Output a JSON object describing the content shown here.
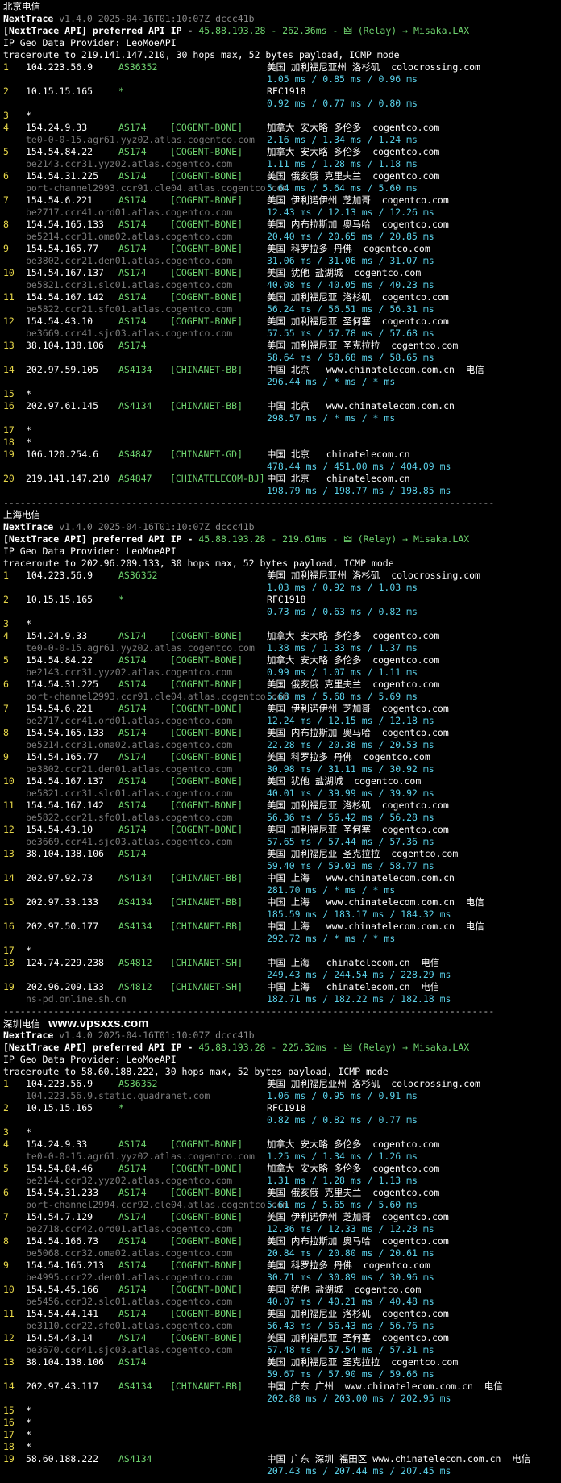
{
  "watermark": "www.vpsxxs.com",
  "sections": [
    {
      "title": "北京电信",
      "nexttrace_label": "NextTrace",
      "version": "v1.4.0 2025-04-16T01:10:07Z dccc41b",
      "api_prefix": "[NextTrace API] preferred API IP - ",
      "api_detail": "45.88.193.28 - 262.36ms - 🜲 (Relay) → Misaka.LAX",
      "geo_provider": "IP Geo Data Provider: LeoMoeAPI",
      "traceroute": "traceroute to 219.141.147.210, 30 hops max, 52 bytes payload, ICMP mode",
      "hops": [
        {
          "n": "1",
          "ip": "104.223.56.9",
          "asn": "AS36352",
          "tag": "",
          "geo": "美国 加利福尼亚州 洛杉矶  colocrossing.com",
          "host": "",
          "rtt": "1.05 ms / 0.85 ms / 0.96 ms"
        },
        {
          "n": "2",
          "ip": "10.15.15.165",
          "asn": "*",
          "tag": "",
          "geo": "RFC1918",
          "host": "",
          "rtt": "0.92 ms / 0.77 ms / 0.80 ms"
        },
        {
          "n": "3",
          "ip": "*",
          "asn": "",
          "tag": "",
          "geo": "",
          "host": "",
          "rtt": ""
        },
        {
          "n": "4",
          "ip": "154.24.9.33",
          "asn": "AS174",
          "tag": "[COGENT-BONE]",
          "geo": "加拿大 安大略 多伦多  cogentco.com",
          "host": "te0-0-0-15.agr61.yyz02.atlas.cogentco.com",
          "rtt": "2.16 ms / 1.34 ms / 1.24 ms"
        },
        {
          "n": "5",
          "ip": "154.54.84.22",
          "asn": "AS174",
          "tag": "[COGENT-BONE]",
          "geo": "加拿大 安大略 多伦多  cogentco.com",
          "host": "be2143.ccr31.yyz02.atlas.cogentco.com",
          "rtt": "1.11 ms / 1.28 ms / 1.18 ms"
        },
        {
          "n": "6",
          "ip": "154.54.31.225",
          "asn": "AS174",
          "tag": "[COGENT-BONE]",
          "geo": "美国 俄亥俄 克里夫兰  cogentco.com",
          "host": "port-channel2993.ccr91.cle04.atlas.cogentco.com",
          "rtt": "5.64 ms / 5.64 ms / 5.60 ms"
        },
        {
          "n": "7",
          "ip": "154.54.6.221",
          "asn": "AS174",
          "tag": "[COGENT-BONE]",
          "geo": "美国 伊利诺伊州 芝加哥  cogentco.com",
          "host": "be2717.ccr41.ord01.atlas.cogentco.com",
          "rtt": "12.43 ms / 12.13 ms / 12.26 ms"
        },
        {
          "n": "8",
          "ip": "154.54.165.133",
          "asn": "AS174",
          "tag": "[COGENT-BONE]",
          "geo": "美国 内布拉斯加 奥马哈  cogentco.com",
          "host": "be5214.ccr31.oma02.atlas.cogentco.com",
          "rtt": "20.40 ms / 20.65 ms / 20.85 ms"
        },
        {
          "n": "9",
          "ip": "154.54.165.77",
          "asn": "AS174",
          "tag": "[COGENT-BONE]",
          "geo": "美国 科罗拉多 丹佛  cogentco.com",
          "host": "be3802.ccr21.den01.atlas.cogentco.com",
          "rtt": "31.06 ms / 31.06 ms / 31.07 ms"
        },
        {
          "n": "10",
          "ip": "154.54.167.137",
          "asn": "AS174",
          "tag": "[COGENT-BONE]",
          "geo": "美国 犹他 盐湖城  cogentco.com",
          "host": "be5821.ccr31.slc01.atlas.cogentco.com",
          "rtt": "40.08 ms / 40.05 ms / 40.23 ms"
        },
        {
          "n": "11",
          "ip": "154.54.167.142",
          "asn": "AS174",
          "tag": "[COGENT-BONE]",
          "geo": "美国 加利福尼亚 洛杉矶  cogentco.com",
          "host": "be5822.ccr21.sfo01.atlas.cogentco.com",
          "rtt": "56.24 ms / 56.51 ms / 56.31 ms"
        },
        {
          "n": "12",
          "ip": "154.54.43.10",
          "asn": "AS174",
          "tag": "[COGENT-BONE]",
          "geo": "美国 加利福尼亚 圣何塞  cogentco.com",
          "host": "be3669.ccr41.sjc03.atlas.cogentco.com",
          "rtt": "57.55 ms / 57.78 ms / 57.68 ms"
        },
        {
          "n": "13",
          "ip": "38.104.138.106",
          "asn": "AS174",
          "tag": "",
          "geo": "美国 加利福尼亚 圣克拉拉  cogentco.com",
          "host": "",
          "rtt": "58.64 ms / 58.68 ms / 58.65 ms"
        },
        {
          "n": "14",
          "ip": "202.97.59.105",
          "asn": "AS4134",
          "tag": "[CHINANET-BB]",
          "geo": "中国 北京   www.chinatelecom.com.cn  电信",
          "host": "",
          "rtt": "296.44 ms / * ms / * ms"
        },
        {
          "n": "15",
          "ip": "*",
          "asn": "",
          "tag": "",
          "geo": "",
          "host": "",
          "rtt": ""
        },
        {
          "n": "16",
          "ip": "202.97.61.145",
          "asn": "AS4134",
          "tag": "[CHINANET-BB]",
          "geo": "中国 北京   www.chinatelecom.com.cn",
          "host": "",
          "rtt": "298.57 ms / * ms / * ms"
        },
        {
          "n": "17",
          "ip": "*",
          "asn": "",
          "tag": "",
          "geo": "",
          "host": "",
          "rtt": ""
        },
        {
          "n": "18",
          "ip": "*",
          "asn": "",
          "tag": "",
          "geo": "",
          "host": "",
          "rtt": ""
        },
        {
          "n": "19",
          "ip": "106.120.254.6",
          "asn": "AS4847",
          "tag": "[CHINANET-GD]",
          "geo": "中国 北京   chinatelecom.cn",
          "host": "",
          "rtt": "478.44 ms / 451.00 ms / 404.09 ms"
        },
        {
          "n": "20",
          "ip": "219.141.147.210",
          "asn": "AS4847",
          "tag": "[CHINATELECOM-BJ]",
          "geo": "中国 北京   chinatelecom.cn",
          "host": "",
          "rtt": "198.79 ms / 198.77 ms / 198.85 ms"
        }
      ]
    },
    {
      "title": "上海电信",
      "nexttrace_label": "NextTrace",
      "version": "v1.4.0 2025-04-16T01:10:07Z dccc41b",
      "api_prefix": "[NextTrace API] preferred API IP - ",
      "api_detail": "45.88.193.28 - 219.61ms - 🜲 (Relay) → Misaka.LAX",
      "geo_provider": "IP Geo Data Provider: LeoMoeAPI",
      "traceroute": "traceroute to 202.96.209.133, 30 hops max, 52 bytes payload, ICMP mode",
      "hops": [
        {
          "n": "1",
          "ip": "104.223.56.9",
          "asn": "AS36352",
          "tag": "",
          "geo": "美国 加利福尼亚州 洛杉矶  colocrossing.com",
          "host": "",
          "rtt": "1.03 ms / 0.92 ms / 1.03 ms"
        },
        {
          "n": "2",
          "ip": "10.15.15.165",
          "asn": "*",
          "tag": "",
          "geo": "RFC1918",
          "host": "",
          "rtt": "0.73 ms / 0.63 ms / 0.82 ms"
        },
        {
          "n": "3",
          "ip": "*",
          "asn": "",
          "tag": "",
          "geo": "",
          "host": "",
          "rtt": ""
        },
        {
          "n": "4",
          "ip": "154.24.9.33",
          "asn": "AS174",
          "tag": "[COGENT-BONE]",
          "geo": "加拿大 安大略 多伦多  cogentco.com",
          "host": "te0-0-0-15.agr61.yyz02.atlas.cogentco.com",
          "rtt": "1.38 ms / 1.33 ms / 1.37 ms"
        },
        {
          "n": "5",
          "ip": "154.54.84.22",
          "asn": "AS174",
          "tag": "[COGENT-BONE]",
          "geo": "加拿大 安大略 多伦多  cogentco.com",
          "host": "be2143.ccr31.yyz02.atlas.cogentco.com",
          "rtt": "0.99 ms / 1.07 ms / 1.11 ms"
        },
        {
          "n": "6",
          "ip": "154.54.31.225",
          "asn": "AS174",
          "tag": "[COGENT-BONE]",
          "geo": "美国 俄亥俄 克里夫兰  cogentco.com",
          "host": "port-channel2993.ccr91.cle04.atlas.cogentco.com",
          "rtt": "5.68 ms / 5.68 ms / 5.69 ms"
        },
        {
          "n": "7",
          "ip": "154.54.6.221",
          "asn": "AS174",
          "tag": "[COGENT-BONE]",
          "geo": "美国 伊利诺伊州 芝加哥  cogentco.com",
          "host": "be2717.ccr41.ord01.atlas.cogentco.com",
          "rtt": "12.24 ms / 12.15 ms / 12.18 ms"
        },
        {
          "n": "8",
          "ip": "154.54.165.133",
          "asn": "AS174",
          "tag": "[COGENT-BONE]",
          "geo": "美国 内布拉斯加 奥马哈  cogentco.com",
          "host": "be5214.ccr31.oma02.atlas.cogentco.com",
          "rtt": "22.28 ms / 20.38 ms / 20.53 ms"
        },
        {
          "n": "9",
          "ip": "154.54.165.77",
          "asn": "AS174",
          "tag": "[COGENT-BONE]",
          "geo": "美国 科罗拉多 丹佛  cogentco.com",
          "host": "be3802.ccr21.den01.atlas.cogentco.com",
          "rtt": "30.98 ms / 31.11 ms / 30.92 ms"
        },
        {
          "n": "10",
          "ip": "154.54.167.137",
          "asn": "AS174",
          "tag": "[COGENT-BONE]",
          "geo": "美国 犹他 盐湖城  cogentco.com",
          "host": "be5821.ccr31.slc01.atlas.cogentco.com",
          "rtt": "40.01 ms / 39.99 ms / 39.92 ms"
        },
        {
          "n": "11",
          "ip": "154.54.167.142",
          "asn": "AS174",
          "tag": "[COGENT-BONE]",
          "geo": "美国 加利福尼亚 洛杉矶  cogentco.com",
          "host": "be5822.ccr21.sfo01.atlas.cogentco.com",
          "rtt": "56.36 ms / 56.42 ms / 56.28 ms"
        },
        {
          "n": "12",
          "ip": "154.54.43.10",
          "asn": "AS174",
          "tag": "[COGENT-BONE]",
          "geo": "美国 加利福尼亚 圣何塞  cogentco.com",
          "host": "be3669.ccr41.sjc03.atlas.cogentco.com",
          "rtt": "57.65 ms / 57.44 ms / 57.36 ms"
        },
        {
          "n": "13",
          "ip": "38.104.138.106",
          "asn": "AS174",
          "tag": "",
          "geo": "美国 加利福尼亚 圣克拉拉  cogentco.com",
          "host": "",
          "rtt": "59.40 ms / 59.03 ms / 58.77 ms"
        },
        {
          "n": "14",
          "ip": "202.97.92.73",
          "asn": "AS4134",
          "tag": "[CHINANET-BB]",
          "geo": "中国 上海   www.chinatelecom.com.cn",
          "host": "",
          "rtt": "281.70 ms / * ms / * ms"
        },
        {
          "n": "15",
          "ip": "202.97.33.133",
          "asn": "AS4134",
          "tag": "[CHINANET-BB]",
          "geo": "中国 上海   www.chinatelecom.com.cn  电信",
          "host": "",
          "rtt": "185.59 ms / 183.17 ms / 184.32 ms"
        },
        {
          "n": "16",
          "ip": "202.97.50.177",
          "asn": "AS4134",
          "tag": "[CHINANET-BB]",
          "geo": "中国 上海   www.chinatelecom.com.cn  电信",
          "host": "",
          "rtt": "292.72 ms / * ms / * ms"
        },
        {
          "n": "17",
          "ip": "*",
          "asn": "",
          "tag": "",
          "geo": "",
          "host": "",
          "rtt": ""
        },
        {
          "n": "18",
          "ip": "124.74.229.238",
          "asn": "AS4812",
          "tag": "[CHINANET-SH]",
          "geo": "中国 上海   chinatelecom.cn  电信",
          "host": "",
          "rtt": "249.43 ms / 244.54 ms / 228.29 ms"
        },
        {
          "n": "19",
          "ip": "202.96.209.133",
          "asn": "AS4812",
          "tag": "[CHINANET-SH]",
          "geo": "中国 上海   chinatelecom.cn  电信",
          "host": "ns-pd.online.sh.cn",
          "rtt": "182.71 ms / 182.22 ms / 182.18 ms"
        }
      ]
    },
    {
      "title": "深圳电信",
      "nexttrace_label": "NextTrace",
      "version": "v1.4.0 2025-04-16T01:10:07Z dccc41b",
      "api_prefix": "[NextTrace API] preferred API IP - ",
      "api_detail": "45.88.193.28 - 225.32ms - 🜲 (Relay) → Misaka.LAX",
      "geo_provider": "IP Geo Data Provider: LeoMoeAPI",
      "traceroute": "traceroute to 58.60.188.222, 30 hops max, 52 bytes payload, ICMP mode",
      "hops": [
        {
          "n": "1",
          "ip": "104.223.56.9",
          "asn": "AS36352",
          "tag": "",
          "geo": "美国 加利福尼亚州 洛杉矶  colocrossing.com",
          "host": "104.223.56.9.static.quadranet.com",
          "rtt": "1.06 ms / 0.95 ms / 0.91 ms"
        },
        {
          "n": "2",
          "ip": "10.15.15.165",
          "asn": "*",
          "tag": "",
          "geo": "RFC1918",
          "host": "",
          "rtt": "0.82 ms / 0.82 ms / 0.77 ms"
        },
        {
          "n": "3",
          "ip": "*",
          "asn": "",
          "tag": "",
          "geo": "",
          "host": "",
          "rtt": ""
        },
        {
          "n": "4",
          "ip": "154.24.9.33",
          "asn": "AS174",
          "tag": "[COGENT-BONE]",
          "geo": "加拿大 安大略 多伦多  cogentco.com",
          "host": "te0-0-0-15.agr61.yyz02.atlas.cogentco.com",
          "rtt": "1.25 ms / 1.34 ms / 1.26 ms"
        },
        {
          "n": "5",
          "ip": "154.54.84.46",
          "asn": "AS174",
          "tag": "[COGENT-BONE]",
          "geo": "加拿大 安大略 多伦多  cogentco.com",
          "host": "be2144.ccr32.yyz02.atlas.cogentco.com",
          "rtt": "1.31 ms / 1.28 ms / 1.13 ms"
        },
        {
          "n": "6",
          "ip": "154.54.31.233",
          "asn": "AS174",
          "tag": "[COGENT-BONE]",
          "geo": "美国 俄亥俄 克里夫兰  cogentco.com",
          "host": "port-channel2994.ccr92.cle04.atlas.cogentco.com",
          "rtt": "5.61 ms / 5.65 ms / 5.60 ms"
        },
        {
          "n": "7",
          "ip": "154.54.7.129",
          "asn": "AS174",
          "tag": "[COGENT-BONE]",
          "geo": "美国 伊利诺伊州 芝加哥  cogentco.com",
          "host": "be2718.ccr42.ord01.atlas.cogentco.com",
          "rtt": "12.36 ms / 12.33 ms / 12.28 ms"
        },
        {
          "n": "8",
          "ip": "154.54.166.73",
          "asn": "AS174",
          "tag": "[COGENT-BONE]",
          "geo": "美国 内布拉斯加 奥马哈  cogentco.com",
          "host": "be5068.ccr32.oma02.atlas.cogentco.com",
          "rtt": "20.84 ms / 20.80 ms / 20.61 ms"
        },
        {
          "n": "9",
          "ip": "154.54.165.213",
          "asn": "AS174",
          "tag": "[COGENT-BONE]",
          "geo": "美国 科罗拉多 丹佛  cogentco.com",
          "host": "be4995.ccr22.den01.atlas.cogentco.com",
          "rtt": "30.71 ms / 30.89 ms / 30.96 ms"
        },
        {
          "n": "10",
          "ip": "154.54.45.166",
          "asn": "AS174",
          "tag": "[COGENT-BONE]",
          "geo": "美国 犹他 盐湖城  cogentco.com",
          "host": "be5456.ccr32.slc01.atlas.cogentco.com",
          "rtt": "40.07 ms / 40.21 ms / 40.48 ms"
        },
        {
          "n": "11",
          "ip": "154.54.44.141",
          "asn": "AS174",
          "tag": "[COGENT-BONE]",
          "geo": "美国 加利福尼亚 洛杉矶  cogentco.com",
          "host": "be3110.ccr22.sfo01.atlas.cogentco.com",
          "rtt": "56.43 ms / 56.43 ms / 56.76 ms"
        },
        {
          "n": "12",
          "ip": "154.54.43.14",
          "asn": "AS174",
          "tag": "[COGENT-BONE]",
          "geo": "美国 加利福尼亚 圣何塞  cogentco.com",
          "host": "be3670.ccr41.sjc03.atlas.cogentco.com",
          "rtt": "57.48 ms / 57.54 ms / 57.31 ms"
        },
        {
          "n": "13",
          "ip": "38.104.138.106",
          "asn": "AS174",
          "tag": "",
          "geo": "美国 加利福尼亚 圣克拉拉  cogentco.com",
          "host": "",
          "rtt": "59.67 ms / 57.90 ms / 59.66 ms"
        },
        {
          "n": "14",
          "ip": "202.97.43.117",
          "asn": "AS4134",
          "tag": "[CHINANET-BB]",
          "geo": "中国 广东 广州  www.chinatelecom.com.cn  电信",
          "host": "",
          "rtt": "202.88 ms / 203.00 ms / 202.95 ms"
        },
        {
          "n": "15",
          "ip": "*",
          "asn": "",
          "tag": "",
          "geo": "",
          "host": "",
          "rtt": ""
        },
        {
          "n": "16",
          "ip": "*",
          "asn": "",
          "tag": "",
          "geo": "",
          "host": "",
          "rtt": ""
        },
        {
          "n": "17",
          "ip": "*",
          "asn": "",
          "tag": "",
          "geo": "",
          "host": "",
          "rtt": ""
        },
        {
          "n": "18",
          "ip": "*",
          "asn": "",
          "tag": "",
          "geo": "",
          "host": "",
          "rtt": ""
        },
        {
          "n": "19",
          "ip": "58.60.188.222",
          "asn": "AS4134",
          "tag": "",
          "geo": "中国 广东 深圳 福田区 www.chinatelecom.com.cn  电信",
          "host": "",
          "rtt": "207.43 ms / 207.44 ms / 207.45 ms"
        }
      ]
    }
  ],
  "separator": "----------------------------------------------------------------------------------------"
}
